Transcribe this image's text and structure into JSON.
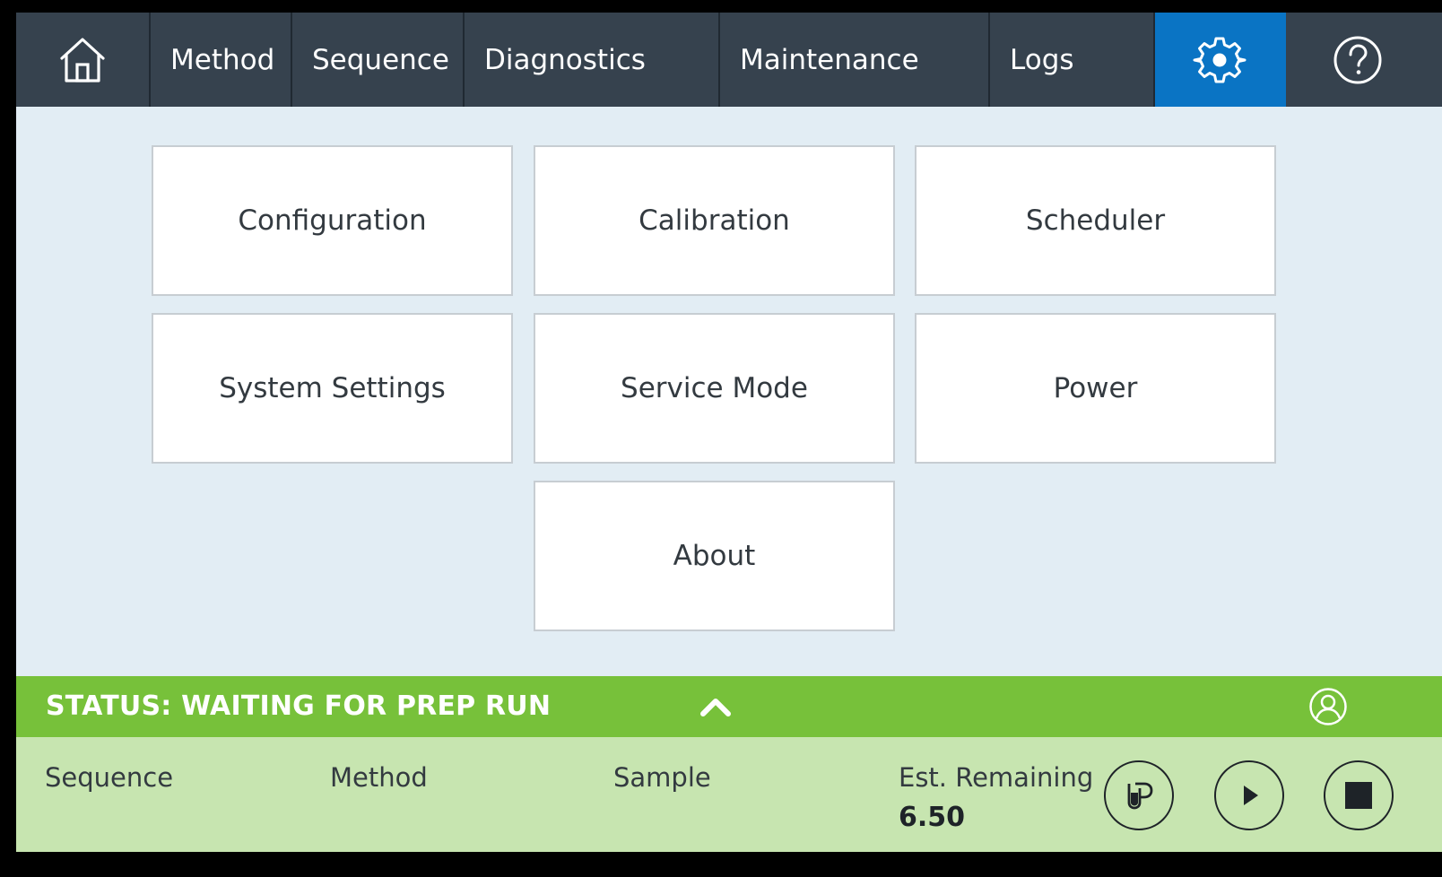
{
  "nav": {
    "home_icon": "home-icon",
    "items": [
      {
        "label": "Method"
      },
      {
        "label": "Sequence"
      },
      {
        "label": "Diagnostics"
      },
      {
        "label": "Maintenance"
      },
      {
        "label": "Logs"
      }
    ],
    "settings_icon": "gear-icon",
    "help_icon": "help-icon",
    "active": "settings"
  },
  "tiles": [
    {
      "label": "Configuration"
    },
    {
      "label": "Calibration"
    },
    {
      "label": "Scheduler"
    },
    {
      "label": "System Settings"
    },
    {
      "label": "Service Mode"
    },
    {
      "label": "Power"
    },
    {
      "label": "About"
    }
  ],
  "status": {
    "text": "STATUS: WAITING FOR PREP RUN",
    "expand_icon": "chevron-up-icon",
    "user_icon": "user-icon"
  },
  "info": {
    "sequence_label": "Sequence",
    "method_label": "Method",
    "sample_label": "Sample",
    "remaining_label": "Est. Remaining",
    "remaining_value": "6.50"
  },
  "controls": {
    "prep_icon": "prep-icon",
    "play_icon": "play-icon",
    "stop_icon": "stop-icon"
  },
  "colors": {
    "nav_bg": "#36424e",
    "active_tab": "#0a74c4",
    "content_bg": "#e2edf4",
    "status_bg": "#77c13a",
    "info_bg": "#c7e5b0"
  }
}
